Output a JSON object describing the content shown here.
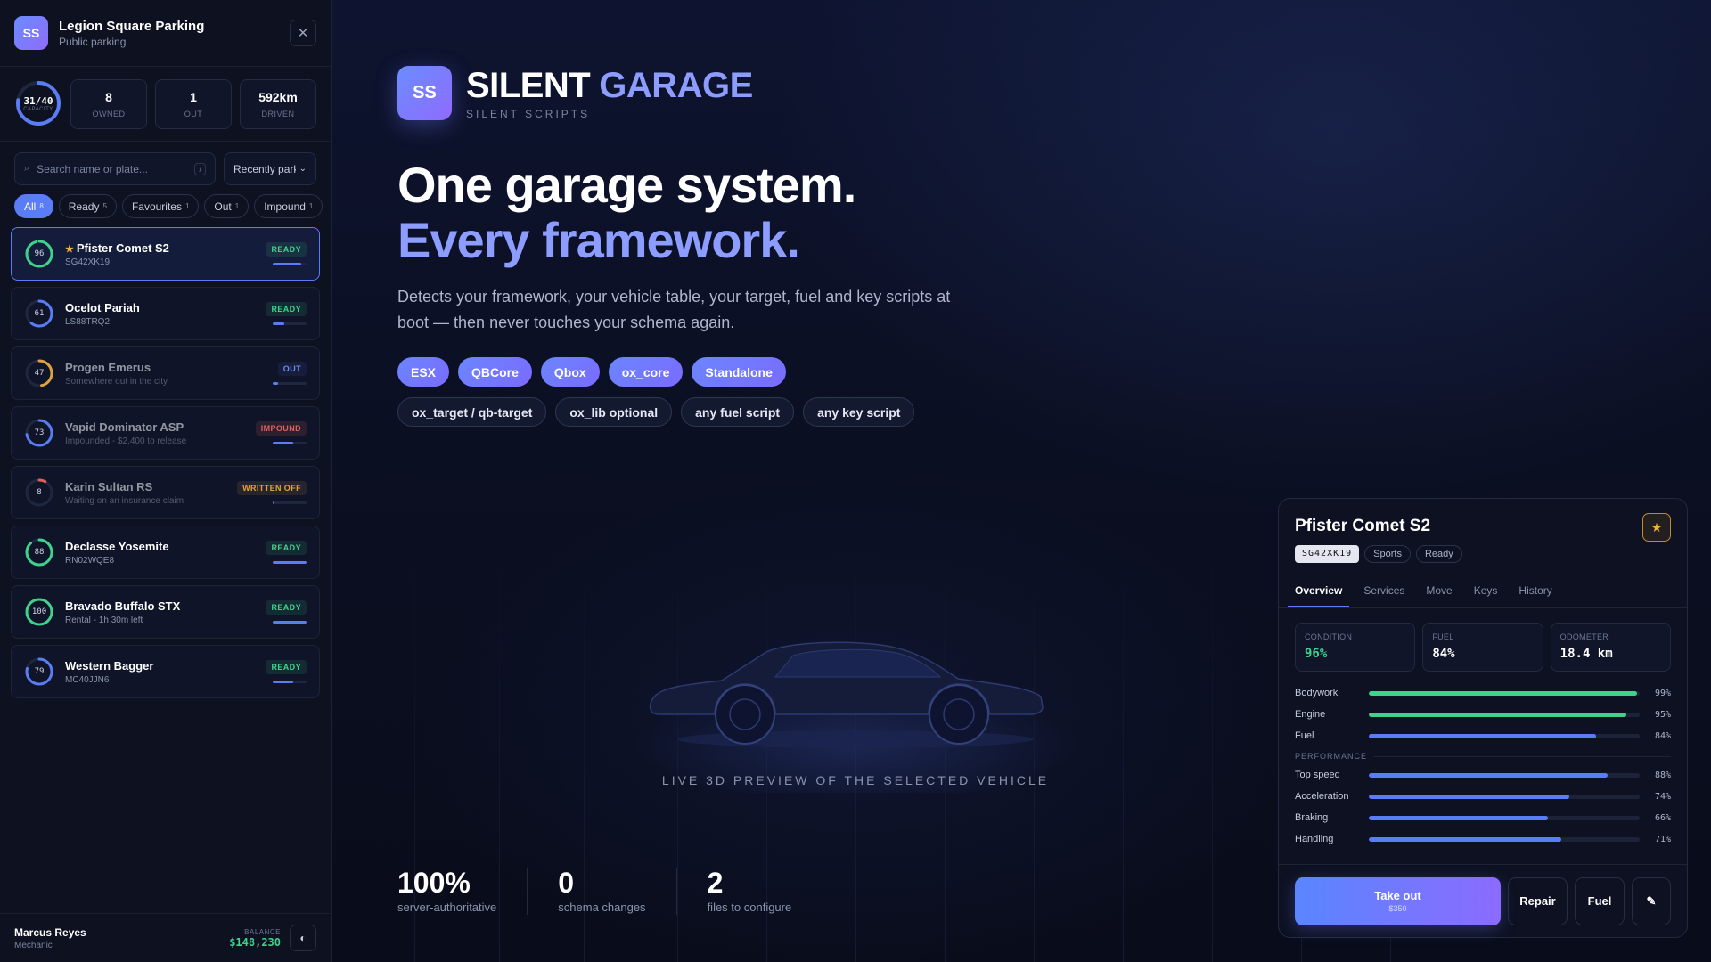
{
  "sidebar": {
    "logo": "SS",
    "title": "Legion Square Parking",
    "subtitle": "Public parking",
    "capacity": {
      "value": "31/40",
      "label": "CAPACITY",
      "fraction": 0.775
    },
    "stats": [
      {
        "value": "8",
        "label": "OWNED"
      },
      {
        "value": "1",
        "label": "OUT"
      },
      {
        "value": "592km",
        "label": "DRIVEN"
      }
    ],
    "search_placeholder": "Search name or plate...",
    "search_shortcut": "/",
    "sort_value": "Recently parked",
    "filters": [
      {
        "label": "All",
        "count": "8",
        "active": true
      },
      {
        "label": "Ready",
        "count": "5"
      },
      {
        "label": "Favourites",
        "count": "1"
      },
      {
        "label": "Out",
        "count": "1"
      },
      {
        "label": "Impound",
        "count": "1"
      }
    ],
    "vehicles": [
      {
        "name": "Pfister Comet S2",
        "sub": "SG42XK19",
        "condition": 96,
        "status": "READY",
        "status_class": "ready",
        "favourite": true,
        "selected": true,
        "ring_color": "#3fd28b",
        "fuel": 0.84
      },
      {
        "name": "Ocelot Pariah",
        "sub": "LS88TRQ2",
        "condition": 61,
        "status": "READY",
        "status_class": "ready",
        "ring_color": "#5a7cf5",
        "fuel": 0.35
      },
      {
        "name": "Progen Emerus",
        "sub": "Somewhere out in the city",
        "condition": 47,
        "status": "OUT",
        "status_class": "out",
        "dim": true,
        "ring_color": "#e0a33c",
        "fuel": 0.15
      },
      {
        "name": "Vapid Dominator ASP",
        "sub": "Impounded - $2,400 to release",
        "condition": 73,
        "status": "IMPOUND",
        "status_class": "impound",
        "dim": true,
        "ring_color": "#5a7cf5",
        "fuel": 0.6
      },
      {
        "name": "Karin Sultan RS",
        "sub": "Waiting on an insurance claim",
        "condition": 8,
        "status": "WRITTEN OFF",
        "status_class": "written",
        "dim": true,
        "ring_color": "#e0615c",
        "fuel": 0.05
      },
      {
        "name": "Declasse Yosemite",
        "sub": "RN02WQE8",
        "condition": 88,
        "status": "READY",
        "status_class": "ready",
        "ring_color": "#3fd28b",
        "fuel": 1.0
      },
      {
        "name": "Bravado Buffalo STX",
        "sub": "Rental - 1h 30m left",
        "condition": 100,
        "status": "READY",
        "status_class": "ready",
        "ring_color": "#3fd28b",
        "fuel": 1.0
      },
      {
        "name": "Western Bagger",
        "sub": "MC40JJN6",
        "condition": 79,
        "status": "READY",
        "status_class": "ready",
        "ring_color": "#5a7cf5",
        "fuel": 0.6
      }
    ],
    "user": {
      "name": "Marcus Reyes",
      "role": "Mechanic"
    },
    "balance": {
      "label": "BALANCE",
      "value": "$148,230"
    }
  },
  "hero": {
    "logo": "SS",
    "brand_white": "SILENT",
    "brand_accent": "GARAGE",
    "brand_sub": "SILENT SCRIPTS",
    "headline_1": "One garage system.",
    "headline_2": "Every framework.",
    "lead": "Detects your framework, your vehicle table, your target, fuel and key scripts at boot — then never touches your schema again.",
    "frameworks": [
      "ESX",
      "QBCore",
      "Qbox",
      "ox_core",
      "Standalone"
    ],
    "integrations": [
      "ox_target / qb-target",
      "ox_lib optional",
      "any fuel script",
      "any key script"
    ],
    "preview_label": "LIVE 3D PREVIEW OF THE SELECTED VEHICLE",
    "metrics": [
      {
        "value": "100%",
        "label": "server-authoritative"
      },
      {
        "value": "0",
        "label": "schema changes"
      },
      {
        "value": "2",
        "label": "files to configure"
      }
    ]
  },
  "detail": {
    "title": "Pfister Comet S2",
    "plate": "SG42XK19",
    "class": "Sports",
    "state": "Ready",
    "tabs": [
      "Overview",
      "Services",
      "Move",
      "Keys",
      "History"
    ],
    "active_tab": "Overview",
    "cards": [
      {
        "label": "CONDITION",
        "value": "96%",
        "green": true
      },
      {
        "label": "FUEL",
        "value": "84%"
      },
      {
        "label": "ODOMETER",
        "value": "18.4 km"
      }
    ],
    "health": [
      {
        "label": "Bodywork",
        "pct": 99,
        "display": "99%",
        "color": "#3fd28b"
      },
      {
        "label": "Engine",
        "pct": 95,
        "display": "95%",
        "color": "#3fd28b"
      },
      {
        "label": "Fuel",
        "pct": 84,
        "display": "84%",
        "color": "#5a7cf5"
      }
    ],
    "performance_label": "PERFORMANCE",
    "performance": [
      {
        "label": "Top speed",
        "pct": 88,
        "display": "88%",
        "color": "#5a7cf5"
      },
      {
        "label": "Acceleration",
        "pct": 74,
        "display": "74%",
        "color": "#5a7cf5"
      },
      {
        "label": "Braking",
        "pct": 66,
        "display": "66%",
        "color": "#5a7cf5"
      },
      {
        "label": "Handling",
        "pct": 71,
        "display": "71%",
        "color": "#5a7cf5"
      }
    ],
    "takeout_label": "Take out",
    "takeout_price": "$350",
    "repair_label": "Repair",
    "fuel_label": "Fuel",
    "edit_icon": "pencil-icon"
  }
}
